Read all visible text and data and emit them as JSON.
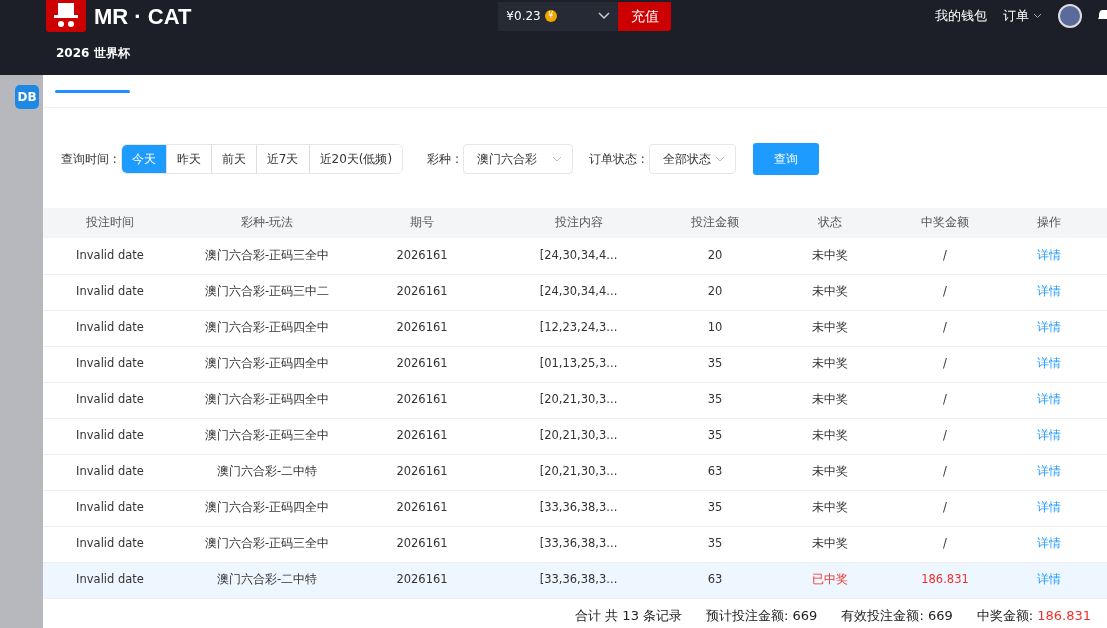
{
  "header": {
    "brand": "MR · CAT",
    "balance": "¥0.23",
    "coin": "¥",
    "recharge": "充值",
    "wallet": "我的钱包",
    "orders": "订单",
    "nav": "2026 世界杯"
  },
  "background": {
    "logo": "DB"
  },
  "filters": {
    "time_label": "查询时间 :",
    "ranges": [
      {
        "label": "今天",
        "selected": true
      },
      {
        "label": "昨天",
        "selected": false
      },
      {
        "label": "前天",
        "selected": false
      },
      {
        "label": "近7天",
        "selected": false
      },
      {
        "label": "近20天(低频)",
        "selected": false
      }
    ],
    "lottery_label": "彩种 :",
    "lottery_value": "澳门六合彩",
    "status_label": "订单状态 :",
    "status_value": "全部状态",
    "search": "查询"
  },
  "table": {
    "columns": [
      "投注时间",
      "彩种-玩法",
      "期号",
      "投注内容",
      "投注金额",
      "状态",
      "中奖金额",
      "操作"
    ],
    "rows": [
      {
        "time": "Invalid date",
        "game": "澳门六合彩-正码三全中",
        "issue": "2026161",
        "content": "[24,30,34,4...",
        "amount": "20",
        "status": "未中奖",
        "won": false,
        "prize": "/",
        "action": "详情",
        "highlighted": false
      },
      {
        "time": "Invalid date",
        "game": "澳门六合彩-正码三中二",
        "issue": "2026161",
        "content": "[24,30,34,4...",
        "amount": "20",
        "status": "未中奖",
        "won": false,
        "prize": "/",
        "action": "详情",
        "highlighted": false
      },
      {
        "time": "Invalid date",
        "game": "澳门六合彩-正码四全中",
        "issue": "2026161",
        "content": "[12,23,24,3...",
        "amount": "10",
        "status": "未中奖",
        "won": false,
        "prize": "/",
        "action": "详情",
        "highlighted": false
      },
      {
        "time": "Invalid date",
        "game": "澳门六合彩-正码四全中",
        "issue": "2026161",
        "content": "[01,13,25,3...",
        "amount": "35",
        "status": "未中奖",
        "won": false,
        "prize": "/",
        "action": "详情",
        "highlighted": false
      },
      {
        "time": "Invalid date",
        "game": "澳门六合彩-正码四全中",
        "issue": "2026161",
        "content": "[20,21,30,3...",
        "amount": "35",
        "status": "未中奖",
        "won": false,
        "prize": "/",
        "action": "详情",
        "highlighted": false
      },
      {
        "time": "Invalid date",
        "game": "澳门六合彩-正码三全中",
        "issue": "2026161",
        "content": "[20,21,30,3...",
        "amount": "35",
        "status": "未中奖",
        "won": false,
        "prize": "/",
        "action": "详情",
        "highlighted": false
      },
      {
        "time": "Invalid date",
        "game": "澳门六合彩-二中特",
        "issue": "2026161",
        "content": "[20,21,30,3...",
        "amount": "63",
        "status": "未中奖",
        "won": false,
        "prize": "/",
        "action": "详情",
        "highlighted": false
      },
      {
        "time": "Invalid date",
        "game": "澳门六合彩-正码四全中",
        "issue": "2026161",
        "content": "[33,36,38,3...",
        "amount": "35",
        "status": "未中奖",
        "won": false,
        "prize": "/",
        "action": "详情",
        "highlighted": false
      },
      {
        "time": "Invalid date",
        "game": "澳门六合彩-正码三全中",
        "issue": "2026161",
        "content": "[33,36,38,3...",
        "amount": "35",
        "status": "未中奖",
        "won": false,
        "prize": "/",
        "action": "详情",
        "highlighted": false
      },
      {
        "time": "Invalid date",
        "game": "澳门六合彩-二中特",
        "issue": "2026161",
        "content": "[33,36,38,3...",
        "amount": "63",
        "status": "已中奖",
        "won": true,
        "prize": "186.831",
        "action": "详情",
        "highlighted": true
      }
    ]
  },
  "summary": {
    "count": "合计 共 13 条记录",
    "expected": "预计投注金额: 669",
    "valid": "有效投注金额: 669",
    "prize_label": "中奖金额:",
    "prize_value": "186.831"
  }
}
